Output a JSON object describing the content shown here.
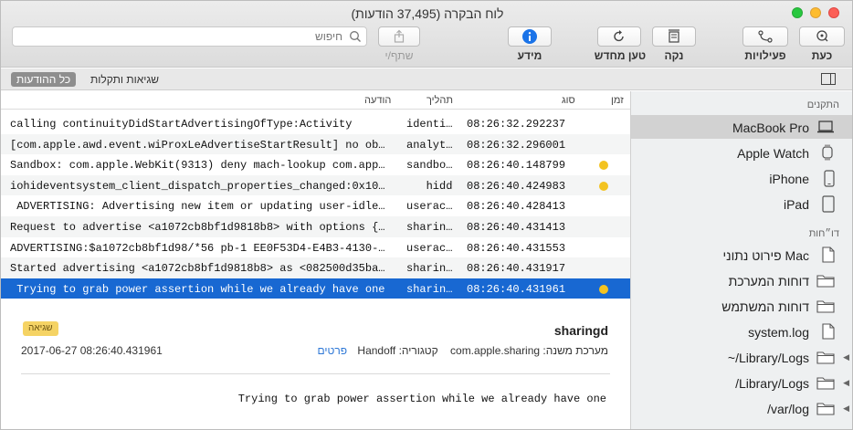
{
  "window": {
    "title": "לוח הבקרה (37,495 הודעות)"
  },
  "toolbar": {
    "now": "כעת",
    "activities": "פעילויות",
    "clear": "נקה",
    "reload": "טען מחדש",
    "info": "מידע",
    "share": "שתף/י",
    "search_placeholder": "חיפוש"
  },
  "filters": {
    "all_messages": "כל ההודעות",
    "errors_faults": "שגיאות ותקלות"
  },
  "columns": {
    "time": "זמן",
    "type": "סוג",
    "process": "תהליך",
    "message": "הודעה"
  },
  "rows": [
    {
      "message": "    calling continuityDidStartAdvertisingOfType:Activity",
      "process": "identi…",
      "time": "08:26:32.292237"
    },
    {
      "message": "[com.apple.awd.event.wiProxLeAdvertiseStartResult] no ob…",
      "process": "analyt…",
      "time": "08:26:32.296001"
    },
    {
      "message": "Sandbox: com.apple.WebKit(9313) deny mach-lookup com.app…",
      "process": "sandbo…",
      "time": "08:26:40.148799"
    },
    {
      "message": "iohideventsystem_client_dispatch_properties_changed:0x10…",
      "process": "   hidd",
      "time": "08:26:40.424983"
    },
    {
      "message": " ADVERTISING: Advertising new item or updating user-idle…",
      "process": "userac…",
      "time": "08:26:40.428413"
    },
    {
      "message": "Request to advertise <a1072cb8bf1d9818b8> with options {…",
      "process": "sharin…",
      "time": "08:26:40.431413"
    },
    {
      "message": "ADVERTISING:$a1072cb8bf1d98/*56 pb-1 EE0F53D4-E4B3-4130-…",
      "process": "userac…",
      "time": "08:26:40.431553"
    },
    {
      "message": "Started advertising <a1072cb8bf1d9818b8> as <082500d35ba…",
      "process": "sharin…",
      "time": "08:26:40.431917"
    },
    {
      "message": " Trying to grab power assertion while we already have one",
      "process": "sharin…",
      "time": "08:26:40.431961"
    }
  ],
  "detail": {
    "process": "sharingd",
    "badge": "שגיאה",
    "subsystem": "מערכת משנה: com.apple.sharing",
    "category": "קטגוריה: Handoff",
    "details_link": "פרטים",
    "timestamp": "2017-06-27 08:26:40.431961",
    "message": "Trying to grab power assertion while we already have one"
  },
  "sidebar": {
    "devices_header": "התקנים",
    "devices": [
      "MacBook Pro",
      "Apple Watch",
      "iPhone",
      "iPad"
    ],
    "reports_header": "דו״חות",
    "reports": [
      "פירוט נתוני Mac",
      "דוחות המערכת",
      "דוחות המשתמש",
      "system.log",
      "~/Library/Logs",
      "/Library/Logs",
      "/var/log"
    ]
  },
  "colors": {
    "selection": "#1868d2",
    "warning_dot": "#f3c321",
    "accent_blue": "#1a73e8"
  }
}
